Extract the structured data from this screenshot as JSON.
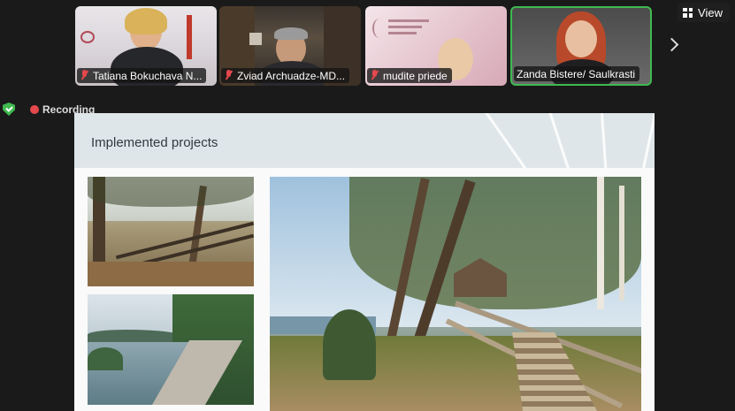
{
  "participants": [
    {
      "name": "Tatiana Bokuchava N...",
      "muted": true,
      "active": false
    },
    {
      "name": "Zviad Archuadze-MD...",
      "muted": true,
      "active": false
    },
    {
      "name": "mudite priede",
      "muted": true,
      "active": false
    },
    {
      "name": "Zanda Bistere/ Saulkrasti",
      "muted": true,
      "active": true
    }
  ],
  "toolbar": {
    "view_label": "View"
  },
  "status": {
    "recording_label": "Recording"
  },
  "slide": {
    "title": "Implemented projects"
  },
  "colors": {
    "active_speaker": "#3fb950",
    "recording": "#e5484d",
    "security": "#3fb950"
  }
}
